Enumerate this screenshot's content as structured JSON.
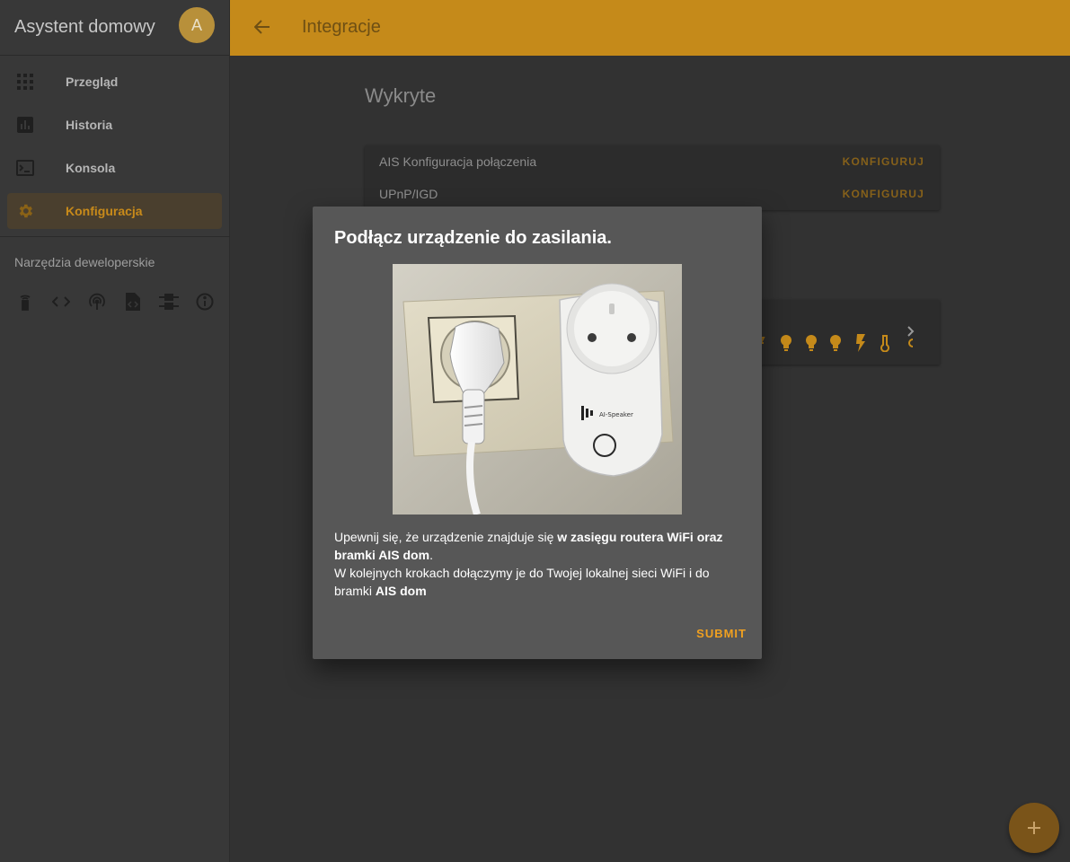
{
  "sidebar": {
    "app_title": "Asystent domowy",
    "avatar_initial": "A",
    "items": [
      {
        "label": "Przegląd",
        "icon": "view-dashboard-icon"
      },
      {
        "label": "Historia",
        "icon": "chart-box-icon"
      },
      {
        "label": "Konsola",
        "icon": "console-icon"
      },
      {
        "label": "Konfiguracja",
        "icon": "gear-icon",
        "active": true
      }
    ],
    "dev_tools_title": "Narzędzia deweloperskie",
    "dev_tools_icons": [
      "remote-icon",
      "code-brackets-icon",
      "broadcast-icon",
      "file-code-icon",
      "timeline-icon",
      "info-icon"
    ]
  },
  "header": {
    "title": "Integracje"
  },
  "main": {
    "discovered_title": "Wykryte",
    "discovered": [
      {
        "name": "AIS Konfiguracja połączenia",
        "action": "KONFIGURUJ"
      },
      {
        "name": "UPnP/IGD",
        "action": "KONFIGURUJ"
      }
    ],
    "entity_icons": [
      "partial-icon",
      "lightbulb-icon",
      "lightbulb-icon",
      "lightbulb-icon",
      "flash-icon",
      "thermometer-icon",
      "partial-icon"
    ]
  },
  "dialog": {
    "title": "Podłącz urządzenie do zasilania.",
    "image_label": "AI-Speaker",
    "text1_pre": "Upewnij się, że urządzenie znajduje się ",
    "text1_bold": "w zasięgu routera WiFi oraz bramki AIS dom",
    "text1_post": ".",
    "text2_pre": "W kolejnych krokach dołączymy je do Twojej lokalnej sieci WiFi i do bramki ",
    "text2_bold": "AIS dom",
    "submit_label": "SUBMIT"
  },
  "colors": {
    "accent": "#c58a1a",
    "sidebar_bg": "#383838",
    "main_bg": "#323232",
    "dialog_bg": "#575757",
    "submit": "#f0a020"
  }
}
